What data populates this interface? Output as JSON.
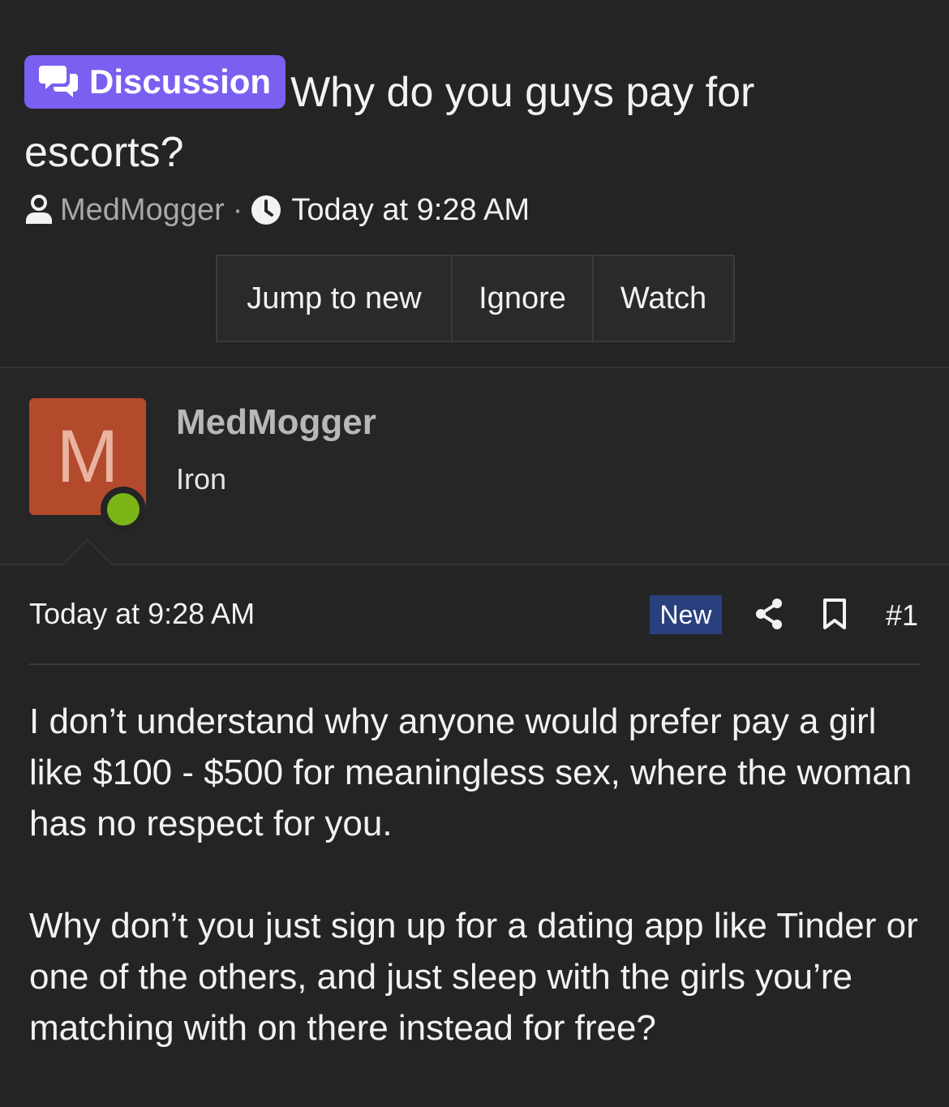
{
  "thread": {
    "prefix_label": "Discussion",
    "title": "Why do you guys pay for escorts?",
    "author": "MedMogger",
    "separator": "·",
    "time": "Today at 9:28 AM"
  },
  "buttons": {
    "jump_to_new": "Jump to new",
    "ignore": "Ignore",
    "watch": "Watch"
  },
  "user": {
    "avatar_letter": "M",
    "name": "MedMogger",
    "rank": "Iron",
    "online": true
  },
  "post": {
    "date": "Today at 9:28 AM",
    "new_label": "New",
    "number": "#1",
    "paragraphs": [
      "I don’t understand why anyone would prefer pay a girl like $100 - $500 for meaningless sex, where the woman has no respect for you.",
      "Why don’t you just sign up for a dating app like Tinder or one of the others, and just sleep with the girls you’re matching with on there instead for free?"
    ]
  },
  "colors": {
    "background": "#242424",
    "prefix_badge": "#7a5ff0",
    "new_badge": "#2a3f7e",
    "avatar": "#b44a2c",
    "online": "#7cb518"
  },
  "icons": {
    "prefix": "comments-icon",
    "author": "user-icon",
    "time": "clock-icon",
    "share": "share-icon",
    "bookmark": "bookmark-icon"
  }
}
